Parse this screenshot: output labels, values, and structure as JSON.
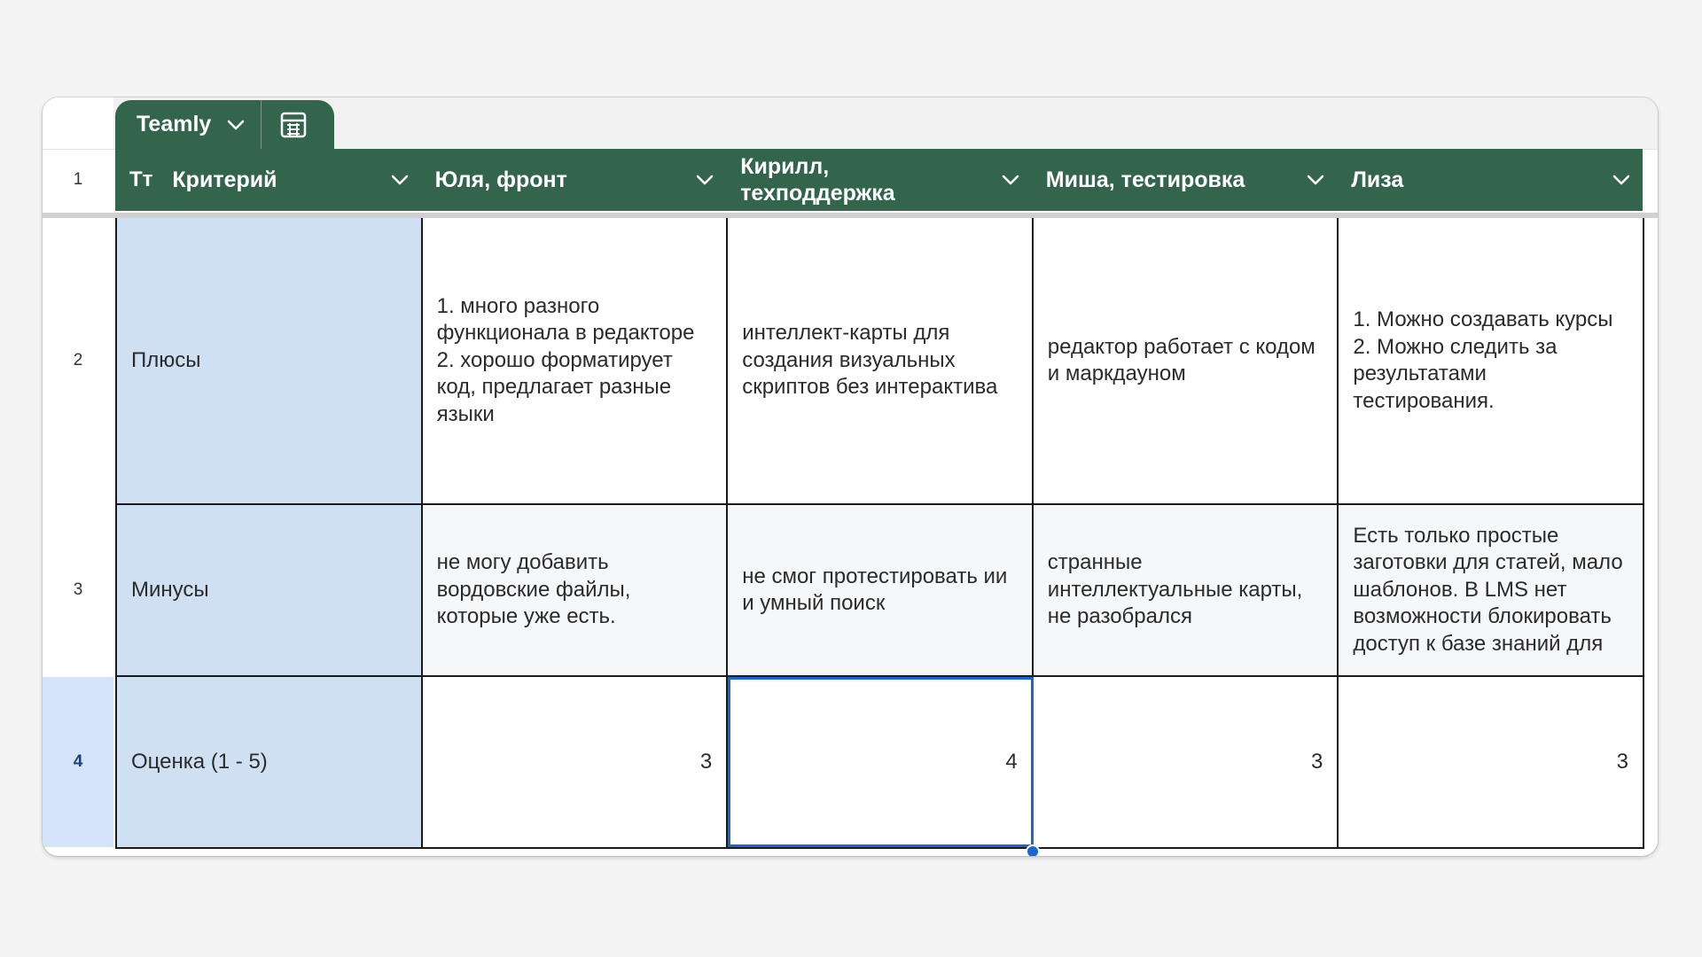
{
  "table_tab": {
    "name": "Teamly",
    "dropdown_icon": "chevron-down-icon",
    "grid_icon": "spreadsheet-icon"
  },
  "header": {
    "row_number": "1",
    "type_icon": "Тт",
    "columns": [
      "Критерий",
      "Юля, фронт",
      "Кирилл,\nтехподдержка",
      "Миша, тестировка",
      "Лиза"
    ]
  },
  "rows": [
    {
      "row_number": "2",
      "criterion": "Плюсы",
      "cells": [
        "1. много разного функционала в редакторе\n2. хорошо форматирует код, предлагает разные языки",
        "интеллект-карты для создания визуальных скриптов без интерактива",
        "редактор работает с кодом и маркдауном",
        "1. Можно создавать курсы\n2. Можно следить за результатами тестирования."
      ]
    },
    {
      "row_number": "3",
      "criterion": "Минусы",
      "cells": [
        "не могу добавить вордовские файлы, которые уже есть.",
        "не смог протестировать ии и умный поиск",
        "странные интеллектуальные карты, не разобрался",
        "Есть только простые заготовки для статей, мало шаблонов. В LMS нет возможности блокировать доступ к базе знаний для"
      ]
    },
    {
      "row_number": "4",
      "criterion": "Оценка (1 - 5)",
      "cells": [
        "3",
        "4",
        "3",
        "3"
      ]
    }
  ],
  "colors": {
    "header_bg": "#33644c",
    "criterion_bg": "#cfe0f3",
    "selection": "#1a66d6",
    "active_row_number_bg": "#d6e4fb"
  },
  "selected_cell": {
    "row": "4",
    "column": "Кирилл, техподдержка"
  }
}
